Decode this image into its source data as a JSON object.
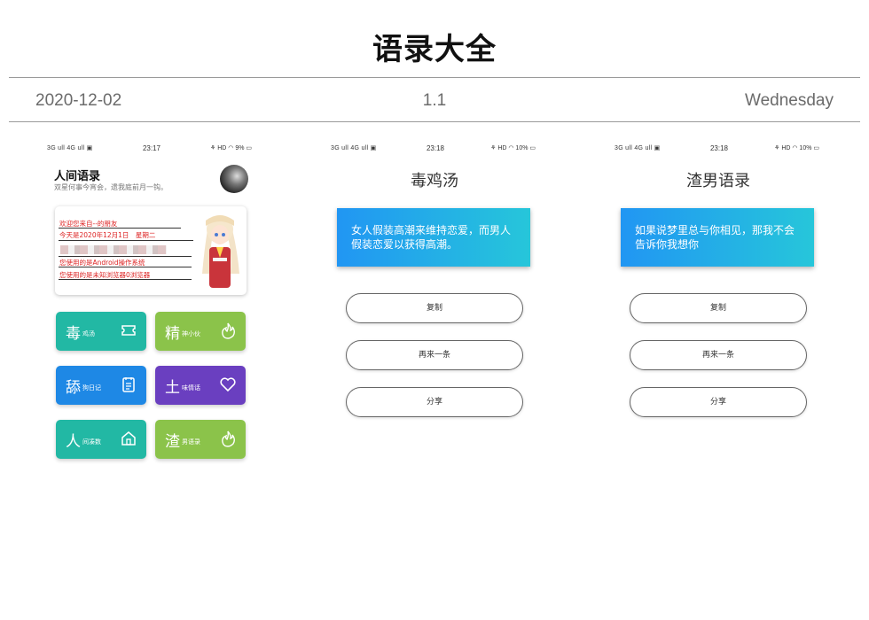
{
  "header": {
    "title": "语录大全",
    "date": "2020-12-02",
    "version": "1.1",
    "weekday": "Wednesday"
  },
  "phones": [
    {
      "status": {
        "signal": "3G ull 4G ull ▣",
        "time": "23:17",
        "system": "⚘ HD ◠ 9% ▭"
      },
      "app_name": "人间语录",
      "app_subtitle": "双星何事今宵会，遗我庭前月一钩。",
      "banner_lines": [
        "欢迎您来自--的朋友",
        "今天是2020年12月1日　星期二",
        "您使用的是Android操作系统",
        "您使用的是未知浏览器0浏览器"
      ],
      "tiles": [
        {
          "big": "毒",
          "small": "鸡汤",
          "icon": "ticket-icon",
          "color": "#22b8a4"
        },
        {
          "big": "精",
          "small": "神小伙",
          "icon": "flame-icon",
          "color": "#8bc34a"
        },
        {
          "big": "舔",
          "small": "狗日记",
          "icon": "notebook-icon",
          "color": "#1e88e5"
        },
        {
          "big": "土",
          "small": "味情话",
          "icon": "heart-icon",
          "color": "#6a3fc0"
        },
        {
          "big": "人",
          "small": "间凑数",
          "icon": "house-icon",
          "color": "#22b8a4"
        },
        {
          "big": "渣",
          "small": "男语录",
          "icon": "flame-icon",
          "color": "#8bc34a"
        }
      ]
    },
    {
      "status": {
        "signal": "3G ull 4G ull ▣",
        "time": "23:18",
        "system": "⚘ HD ◠ 10% ▭"
      },
      "title": "毒鸡汤",
      "quote": "女人假装高潮来维持恋爱，而男人假装恋爱以获得高潮。",
      "buttons": [
        "复制",
        "再来一条",
        "分享"
      ]
    },
    {
      "status": {
        "signal": "3G ull 4G ull ▣",
        "time": "23:18",
        "system": "⚘ HD ◠ 10% ▭"
      },
      "title": "渣男语录",
      "quote": "如果说梦里总与你相见，那我不会告诉你我想你",
      "buttons": [
        "复制",
        "再来一条",
        "分享"
      ]
    }
  ]
}
